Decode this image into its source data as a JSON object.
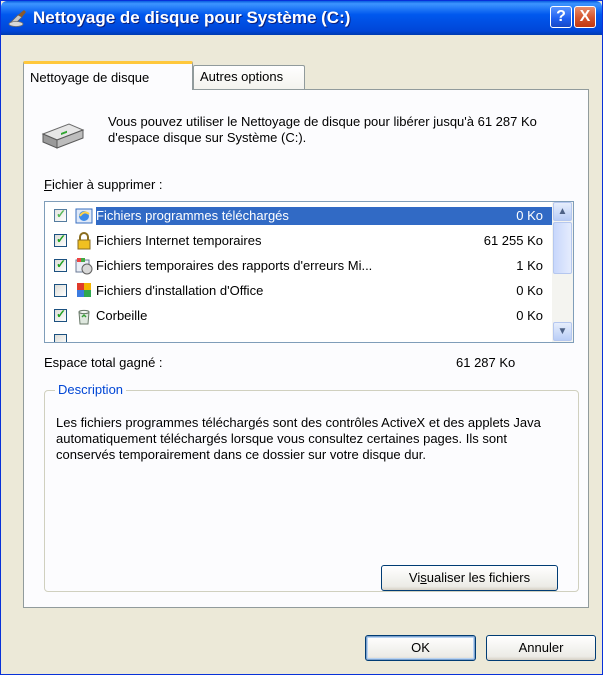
{
  "window": {
    "title": "Nettoyage de disque pour Système (C:)",
    "help_label": "?",
    "close_label": "X"
  },
  "tabs": [
    {
      "label": "Nettoyage de disque",
      "active": true
    },
    {
      "label": "Autres options",
      "active": false
    }
  ],
  "info": {
    "text": "Vous pouvez utiliser le Nettoyage de disque pour libérer jusqu'à 61 287 Ko d'espace disque sur Système (C:)."
  },
  "files_label": {
    "accel": "F",
    "rest": "ichier à supprimer :"
  },
  "files": [
    {
      "name": "Fichiers programmes téléchargés",
      "size": "0 Ko",
      "checked": true,
      "selected": true,
      "icon": "ie-globe-icon"
    },
    {
      "name": "Fichiers Internet temporaires",
      "size": "61 255 Ko",
      "checked": true,
      "selected": false,
      "icon": "lock-icon"
    },
    {
      "name": "Fichiers temporaires des rapports d'erreurs Mi...",
      "size": "1 Ko",
      "checked": true,
      "selected": false,
      "icon": "error-report-icon"
    },
    {
      "name": "Fichiers d'installation d'Office",
      "size": "0 Ko",
      "checked": false,
      "selected": false,
      "icon": "office-icon"
    },
    {
      "name": "Corbeille",
      "size": "0 Ko",
      "checked": true,
      "selected": false,
      "icon": "recycle-bin-icon"
    }
  ],
  "total": {
    "label": "Espace total gagné :",
    "value": "61 287 Ko"
  },
  "description": {
    "legend": "Description",
    "text": "Les fichiers programmes téléchargés sont des contrôles ActiveX et des applets Java automatiquement téléchargés lorsque vous consultez certaines pages. Ils sont conservés temporairement dans ce dossier sur votre disque dur."
  },
  "buttons": {
    "view_pre": "Vi",
    "view_accel": "s",
    "view_post": "ualiser les fichiers",
    "ok": "OK",
    "cancel": "Annuler"
  }
}
